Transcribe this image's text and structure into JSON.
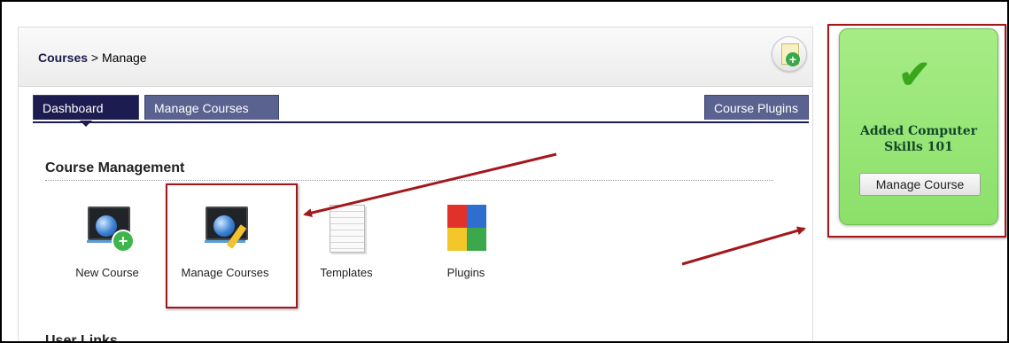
{
  "breadcrumb": {
    "root": "Courses",
    "separator": " > ",
    "current": "Manage"
  },
  "header_action": {
    "icon": "add-document-icon"
  },
  "tabs": [
    {
      "label": "Dashboard",
      "active": true
    },
    {
      "label": "Manage Courses",
      "active": false
    },
    {
      "label": "Course Plugins",
      "active": false
    }
  ],
  "sections": {
    "course_management": "Course Management",
    "user_links": "User Links"
  },
  "tools": [
    {
      "label": "New Course",
      "icon": "new-course-icon"
    },
    {
      "label": "Manage Courses",
      "icon": "manage-courses-icon"
    },
    {
      "label": "Templates",
      "icon": "templates-icon"
    },
    {
      "label": "Plugins",
      "icon": "plugins-icon"
    }
  ],
  "notice": {
    "icon": "checkmark-icon",
    "message": "Added Computer Skills 101",
    "button_label": "Manage Course"
  },
  "colors": {
    "tab_active": "#1c1c50",
    "tab_inactive": "#5a6290",
    "notice_bg": "#9be879",
    "highlight": "#a3171b"
  }
}
